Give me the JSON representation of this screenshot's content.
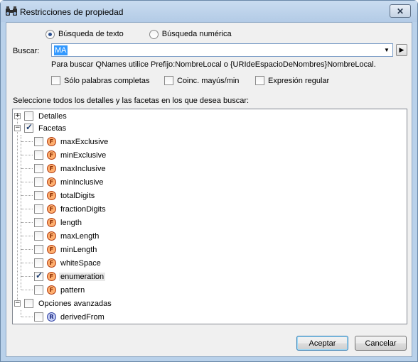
{
  "window": {
    "title": "Restricciones de propiedad",
    "close_glyph": "✕"
  },
  "search_mode": {
    "options": [
      {
        "label": "Búsqueda de texto",
        "selected": true
      },
      {
        "label": "Búsqueda numérica",
        "selected": false
      }
    ]
  },
  "search": {
    "label": "Buscar:",
    "value": "MA",
    "dropdown_glyph": "▼",
    "go_glyph": "▶",
    "hint": "Para buscar QNames utilice Prefijo:NombreLocal o {URIdeEspacioDeNombres}NombreLocal."
  },
  "options": {
    "whole_words": {
      "label": "Sólo palabras completas",
      "checked": false
    },
    "match_case": {
      "label": "Coinc. mayús/min",
      "checked": false
    },
    "regex": {
      "label": "Expresión regular",
      "checked": false
    }
  },
  "tree": {
    "caption": "Seleccione todos los detalles y las facetas en los que desea buscar:",
    "nodes": [
      {
        "label": "Detalles",
        "checked": false,
        "expander": "+"
      },
      {
        "label": "Facetas",
        "checked": true,
        "expander": "−"
      },
      {
        "label": "maxExclusive",
        "checked": false,
        "icon": "F"
      },
      {
        "label": "minExclusive",
        "checked": false,
        "icon": "F"
      },
      {
        "label": "maxInclusive",
        "checked": false,
        "icon": "F"
      },
      {
        "label": "minInclusive",
        "checked": false,
        "icon": "F"
      },
      {
        "label": "totalDigits",
        "checked": false,
        "icon": "F"
      },
      {
        "label": "fractionDigits",
        "checked": false,
        "icon": "F"
      },
      {
        "label": "length",
        "checked": false,
        "icon": "F"
      },
      {
        "label": "maxLength",
        "checked": false,
        "icon": "F"
      },
      {
        "label": "minLength",
        "checked": false,
        "icon": "F"
      },
      {
        "label": "whiteSpace",
        "checked": false,
        "icon": "F"
      },
      {
        "label": "enumeration",
        "checked": true,
        "icon": "F"
      },
      {
        "label": "pattern",
        "checked": false,
        "icon": "F"
      },
      {
        "label": "Opciones avanzadas",
        "checked": false,
        "expander": "−"
      },
      {
        "label": "derivedFrom",
        "checked": false,
        "icon": "R"
      }
    ]
  },
  "buttons": {
    "ok": "Aceptar",
    "cancel": "Cancelar"
  }
}
